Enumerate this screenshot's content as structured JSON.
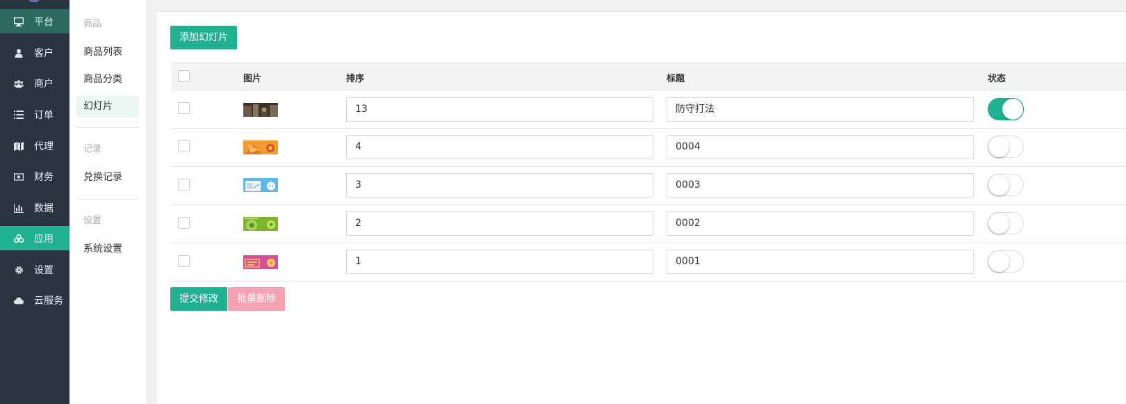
{
  "nav": {
    "items": [
      {
        "label": "平台",
        "icon": "monitor-icon"
      },
      {
        "label": "客户",
        "icon": "user-icon"
      },
      {
        "label": "商户",
        "icon": "users-icon"
      },
      {
        "label": "订单",
        "icon": "list-icon"
      },
      {
        "label": "代理",
        "icon": "map-icon"
      },
      {
        "label": "财务",
        "icon": "money-icon"
      },
      {
        "label": "数据",
        "icon": "bar-chart-icon"
      },
      {
        "label": "应用",
        "icon": "cubes-icon"
      },
      {
        "label": "设置",
        "icon": "gear-icon"
      },
      {
        "label": "云服务",
        "icon": "cloud-icon"
      }
    ],
    "active": "应用"
  },
  "subnav": {
    "groups": [
      {
        "title": "商品",
        "items": [
          "商品列表",
          "商品分类",
          "幻灯片"
        ]
      },
      {
        "title": "记录",
        "items": [
          "兑换记录"
        ]
      },
      {
        "title": "设置",
        "items": [
          "系统设置"
        ]
      }
    ],
    "active": "幻灯片"
  },
  "main": {
    "add_button": "添加幻灯片",
    "columns": [
      "图片",
      "排序",
      "标题",
      "状态"
    ],
    "rows": [
      {
        "sort": "13",
        "title": "防守打法",
        "enabled": true
      },
      {
        "sort": "4",
        "title": "0004",
        "enabled": false
      },
      {
        "sort": "3",
        "title": "0003",
        "enabled": false
      },
      {
        "sort": "2",
        "title": "0002",
        "enabled": false
      },
      {
        "sort": "1",
        "title": "0001",
        "enabled": false
      }
    ],
    "submit_button": "提交修改",
    "batch_delete_button": "批量删除"
  },
  "colors": {
    "accent": "#1fb192",
    "nav_bg": "#2a3541",
    "danger_light": "#f7a2b0"
  }
}
